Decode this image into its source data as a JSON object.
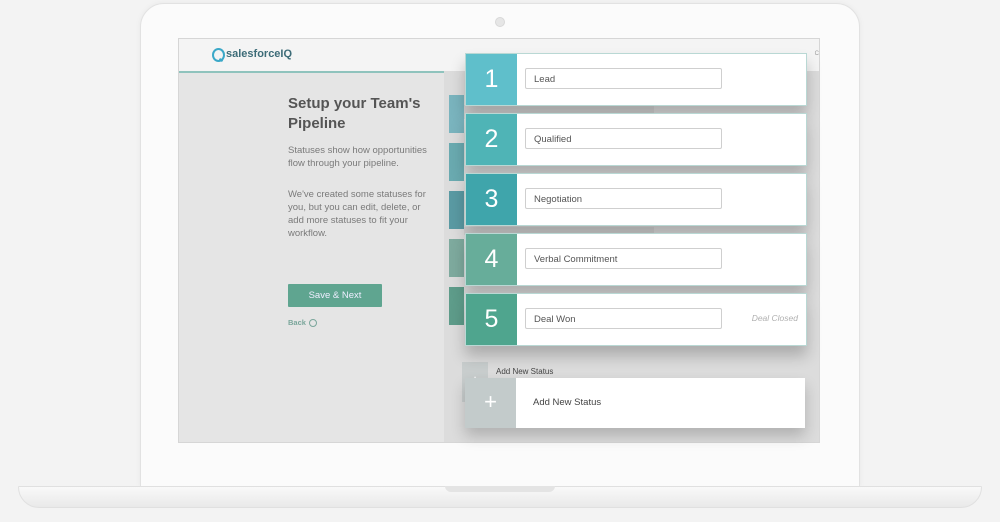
{
  "app": {
    "logo_text": "salesforceIQ",
    "topbar_right": "C"
  },
  "intro": {
    "title": "Setup your Team's Pipeline",
    "description_1": "Statuses show how opportunities flow through your pipeline.",
    "description_2": "We've created some statuses for you, but you can edit, delete, or add more statuses to fit your workflow.",
    "save_label": "Save & Next",
    "back_label": "Back"
  },
  "pipeline": {
    "statuses": [
      {
        "number": "1",
        "name": "Lead",
        "note": "",
        "color": "#5fbfcb"
      },
      {
        "number": "2",
        "name": "Qualified",
        "note": "",
        "color": "#4fb4b6"
      },
      {
        "number": "3",
        "name": "Negotiation",
        "note": "",
        "color": "#3fa5ab"
      },
      {
        "number": "4",
        "name": "Verbal Commitment",
        "note": "",
        "color": "#67ad9a"
      },
      {
        "number": "5",
        "name": "Deal Won",
        "note": "Deal Closed",
        "color": "#4fa58e"
      }
    ],
    "add_label": "Add New Status",
    "add_label_background": "Add New Status",
    "add_icon": "+"
  }
}
